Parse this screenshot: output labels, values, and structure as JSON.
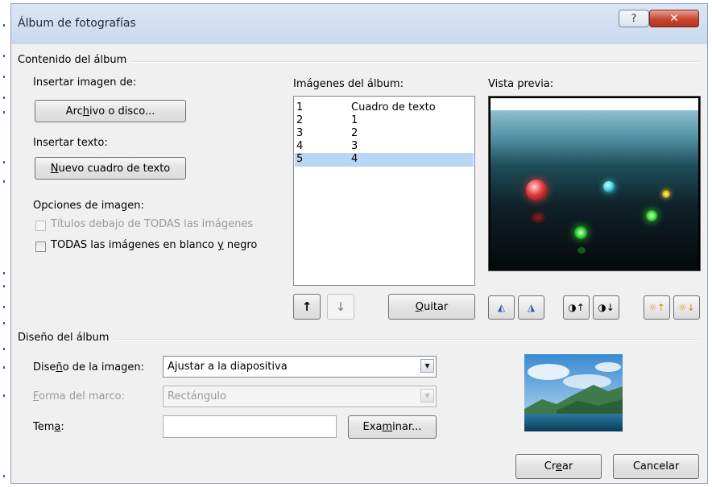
{
  "window": {
    "title": "Álbum de fotografías",
    "help_glyph": "?",
    "close_glyph": "✕"
  },
  "album_content": {
    "group_label": "Contenido del álbum",
    "insert_picture_label": "Insertar imagen de:",
    "file_button": {
      "pre": "Arc",
      "key": "h",
      "post": "ivo o disco..."
    },
    "insert_text_label": "Insertar texto:",
    "new_textbox_button": {
      "pre": "",
      "key": "N",
      "post": "uevo cuadro de texto"
    },
    "picture_options_label": "Opciones de imagen:",
    "captions_checkbox": {
      "label": "Títulos debajo de TODAS las imágenes",
      "checked": false,
      "enabled": false
    },
    "bw_checkbox": {
      "pre": "TODAS las imágenes en blanco ",
      "key": "y",
      "post": " negro",
      "checked": false,
      "enabled": true
    },
    "pictures_label": "Imágenes del álbum:",
    "pictures": [
      {
        "num": "1",
        "name": "Cuadro de texto",
        "selected": false
      },
      {
        "num": "2",
        "name": "1",
        "selected": false
      },
      {
        "num": "3",
        "name": "2",
        "selected": false
      },
      {
        "num": "4",
        "name": "3",
        "selected": false
      },
      {
        "num": "5",
        "name": "4",
        "selected": true
      }
    ],
    "move_up_glyph": "↑",
    "move_down_glyph": "↓",
    "remove_button": {
      "pre": "",
      "key": "Q",
      "post": "uitar"
    },
    "preview_label": "Vista previa:",
    "preview_tools": [
      {
        "icon": "rotate-left-icon",
        "glyph": "◭"
      },
      {
        "icon": "rotate-right-icon",
        "glyph": "◮"
      },
      {
        "icon": "contrast-up-icon",
        "glyph": "◑↑"
      },
      {
        "icon": "contrast-down-icon",
        "glyph": "◑↓"
      },
      {
        "icon": "brightness-up-icon",
        "glyph": "☼↑"
      },
      {
        "icon": "brightness-down-icon",
        "glyph": "☼↓"
      }
    ]
  },
  "album_layout": {
    "group_label": "Diseño del álbum",
    "picture_layout_label": {
      "pre": "Dise",
      "key": "ñ",
      "post": "o de la imagen:"
    },
    "picture_layout_value": "Ajustar a la diapositiva",
    "frame_shape_label": {
      "pre": "",
      "key": "F",
      "post": "orma del marco:"
    },
    "frame_shape_value": "Rectángulo",
    "theme_label": {
      "pre": "Tem",
      "key": "a",
      "post": ":"
    },
    "theme_value": "",
    "browse_button": {
      "pre": "Exa",
      "key": "m",
      "post": "inar..."
    }
  },
  "footer": {
    "create_button": {
      "pre": "Cr",
      "key": "e",
      "post": "ar"
    },
    "cancel_button": "Cancelar"
  },
  "colors": {
    "selection": "#b9d6f6",
    "close_red": "#c74531",
    "titlebar": "#c9d9ee"
  }
}
